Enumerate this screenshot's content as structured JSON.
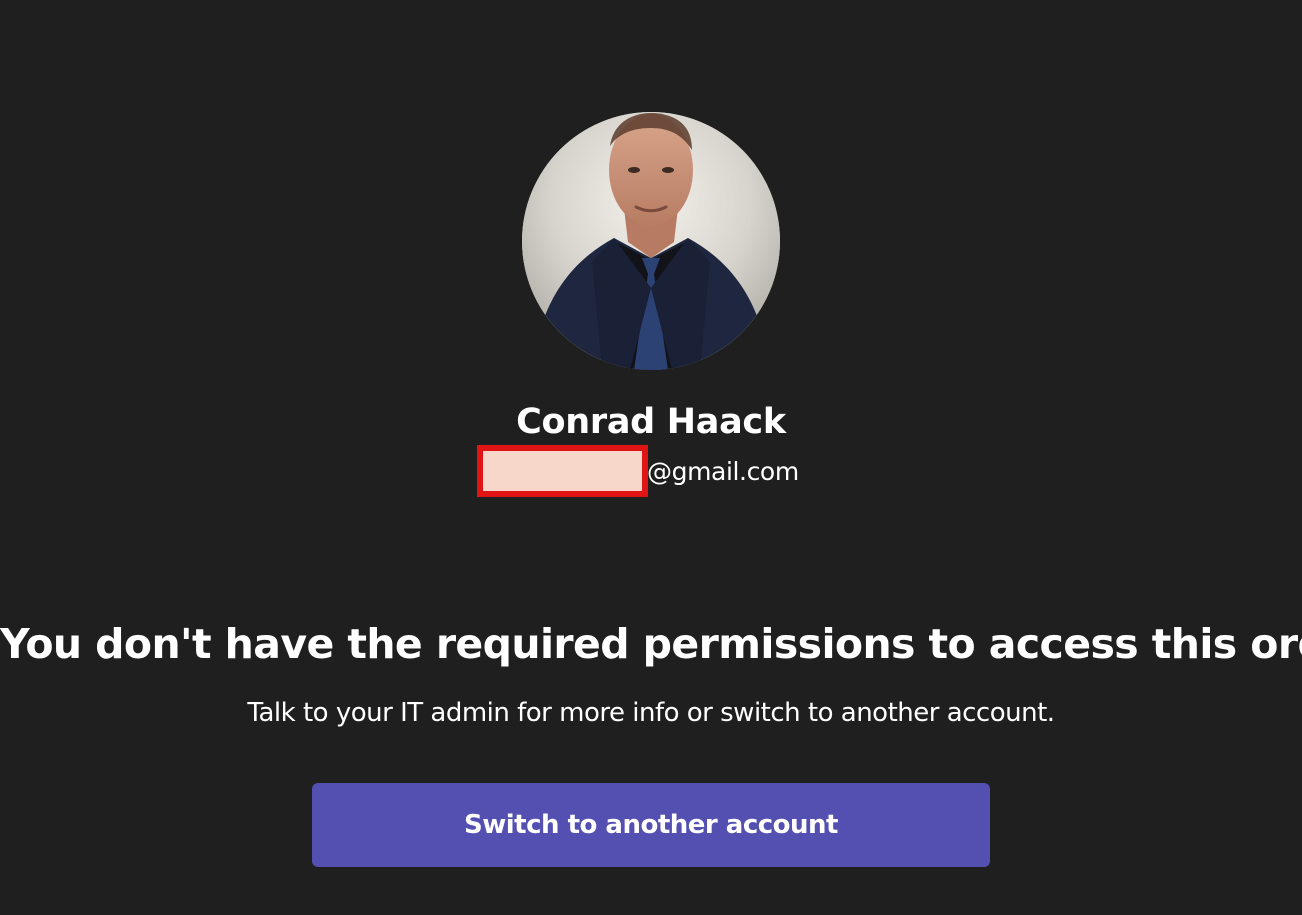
{
  "profile": {
    "name": "Conrad Haack",
    "email_domain": "@gmail.com",
    "avatar_icon": "profile-photo"
  },
  "message": {
    "heading": "You don't have the required permissions to access this org",
    "body": "Talk to your IT admin for more info or switch to another account."
  },
  "actions": {
    "switch_account_label": "Switch to another account"
  },
  "colors": {
    "background": "#1f1f1f",
    "primary_button": "#5350b2",
    "redaction_border": "#e01414",
    "redaction_fill": "#f6d7c9"
  }
}
